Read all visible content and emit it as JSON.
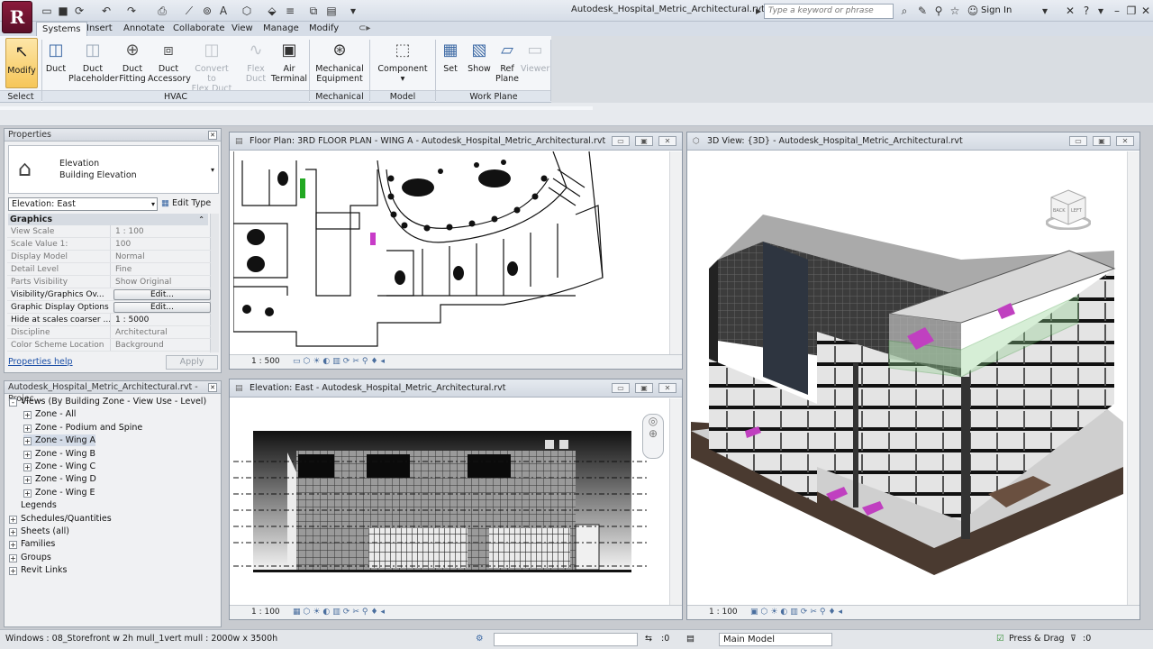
{
  "app": {
    "logo_letter": "R",
    "doc_title": "Autodesk_Hospital_Metric_Architectural.rvt",
    "search_placeholder": "Type a keyword or phrase",
    "sign_in": "Sign In"
  },
  "tabs": [
    "Systems",
    "Insert",
    "Annotate",
    "Collaborate",
    "View",
    "Manage",
    "Modify"
  ],
  "ribbon": {
    "buttons": [
      {
        "label1": "Modify",
        "label2": "",
        "icon": "cursor-icon"
      },
      {
        "label1": "Duct",
        "label2": "",
        "icon": "duct-icon"
      },
      {
        "label1": "Duct",
        "label2": "Placeholder",
        "icon": "duct-placeholder-icon"
      },
      {
        "label1": "Duct",
        "label2": "Fitting",
        "icon": "duct-fitting-icon"
      },
      {
        "label1": "Duct",
        "label2": "Accessory",
        "icon": "duct-accessory-icon"
      },
      {
        "label1": "Convert to",
        "label2": "Flex Duct",
        "icon": "convert-flex-icon"
      },
      {
        "label1": "Flex",
        "label2": "Duct",
        "icon": "flex-duct-icon"
      },
      {
        "label1": "Air",
        "label2": "Terminal",
        "icon": "air-terminal-icon"
      },
      {
        "label1": "Mechanical",
        "label2": "Equipment",
        "icon": "mechanical-equipment-icon"
      },
      {
        "label1": "Component",
        "label2": "",
        "icon": "component-icon"
      },
      {
        "label1": "Set",
        "label2": "",
        "icon": "set-workplane-icon"
      },
      {
        "label1": "Show",
        "label2": "",
        "icon": "show-workplane-icon"
      },
      {
        "label1": "Ref",
        "label2": "Plane",
        "icon": "ref-plane-icon"
      },
      {
        "label1": "Viewer",
        "label2": "",
        "icon": "viewer-icon"
      }
    ],
    "panels": [
      "Select",
      "HVAC",
      "Mechanical",
      "Model",
      "Work Plane"
    ]
  },
  "properties": {
    "title": "Properties",
    "type_name": "Elevation",
    "type_sub": "Building Elevation",
    "instance": "Elevation: East",
    "edit_type": "Edit Type",
    "group": "Graphics",
    "rows": [
      {
        "k": "View Scale",
        "v": "1 : 100"
      },
      {
        "k": "Scale Value    1:",
        "v": "100"
      },
      {
        "k": "Display Model",
        "v": "Normal"
      },
      {
        "k": "Detail Level",
        "v": "Fine"
      },
      {
        "k": "Parts Visibility",
        "v": "Show Original"
      },
      {
        "k": "Visibility/Graphics Ov...",
        "v": "Edit..."
      },
      {
        "k": "Graphic Display Options",
        "v": "Edit..."
      },
      {
        "k": "Hide at scales coarser ...",
        "v": "1 : 5000"
      },
      {
        "k": "Discipline",
        "v": "Architectural"
      },
      {
        "k": "Color Scheme Location",
        "v": "Background"
      }
    ],
    "help": "Properties help",
    "apply": "Apply"
  },
  "browser": {
    "title": "Autodesk_Hospital_Metric_Architectural.rvt - Projec...",
    "items": [
      {
        "label": "Views (By Building Zone - View Use - Level)",
        "level": 0,
        "box": "-"
      },
      {
        "label": "Zone - All",
        "level": 1,
        "box": "+"
      },
      {
        "label": "Zone - Podium and Spine",
        "level": 1,
        "box": "+"
      },
      {
        "label": "Zone - Wing A",
        "level": 1,
        "box": "+"
      },
      {
        "label": "Zone - Wing B",
        "level": 1,
        "box": "+"
      },
      {
        "label": "Zone - Wing C",
        "level": 1,
        "box": "+"
      },
      {
        "label": "Zone - Wing D",
        "level": 1,
        "box": "+"
      },
      {
        "label": "Zone - Wing E",
        "level": 1,
        "box": "+"
      },
      {
        "label": "Legends",
        "level": 0,
        "box": ""
      },
      {
        "label": "Schedules/Quantities",
        "level": 0,
        "box": "+"
      },
      {
        "label": "Sheets (all)",
        "level": 0,
        "box": "+"
      },
      {
        "label": "Families",
        "level": 0,
        "box": "+"
      },
      {
        "label": "Groups",
        "level": 0,
        "box": "+"
      },
      {
        "label": "Revit Links",
        "level": 0,
        "box": "+"
      }
    ]
  },
  "views": {
    "floor": {
      "title": "Floor Plan: 3RD FLOOR PLAN - WING A - Autodesk_Hospital_Metric_Architectural.rvt",
      "scale": "1 : 500"
    },
    "elev": {
      "title": "Elevation: East - Autodesk_Hospital_Metric_Architectural.rvt",
      "scale": "1 : 100"
    },
    "three_d": {
      "title": "3D View: {3D} - Autodesk_Hospital_Metric_Architectural.rvt",
      "scale": "1 : 100"
    }
  },
  "viewcube": {
    "back": "BACK",
    "left": "LEFT"
  },
  "status": {
    "message": "Windows : 08_Storefront w 2h mull_1vert mull : 2000w x 3500h",
    "worksets": ":0",
    "model": "Main Model",
    "press_drag": "Press & Drag",
    "filter": ":0"
  }
}
